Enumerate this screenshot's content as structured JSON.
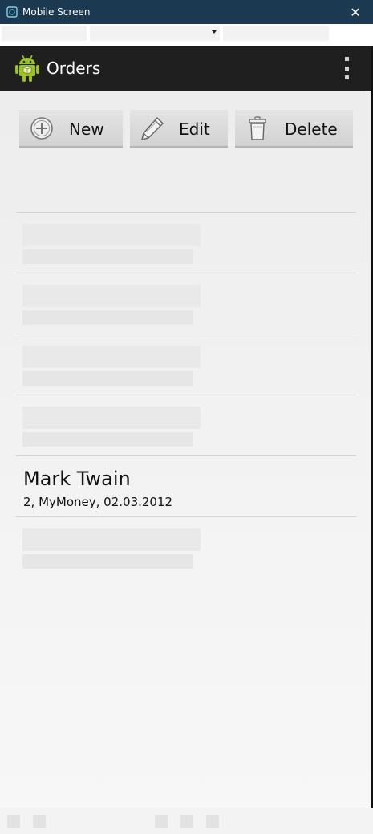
{
  "window": {
    "title": "Mobile Screen",
    "close_glyph": "✕",
    "icon": "mobile-screen-icon"
  },
  "actionbar": {
    "title": "Orders",
    "app_icon": "android-robot-icon",
    "overflow_icon": "overflow-menu-icon"
  },
  "buttons": {
    "new_label": "New",
    "edit_label": "Edit",
    "delete_label": "Delete"
  },
  "orders": [
    {
      "name": "",
      "details": ""
    },
    {
      "name": "",
      "details": ""
    },
    {
      "name": "",
      "details": ""
    },
    {
      "name": "",
      "details": ""
    },
    {
      "name": "Mark Twain",
      "details": "2, MyMoney, 02.03.2012"
    },
    {
      "name": "",
      "details": ""
    }
  ],
  "colors": {
    "titlebar": "#1b3a52",
    "actionbar": "#1f1f1f",
    "android_green": "#9cc31f"
  }
}
